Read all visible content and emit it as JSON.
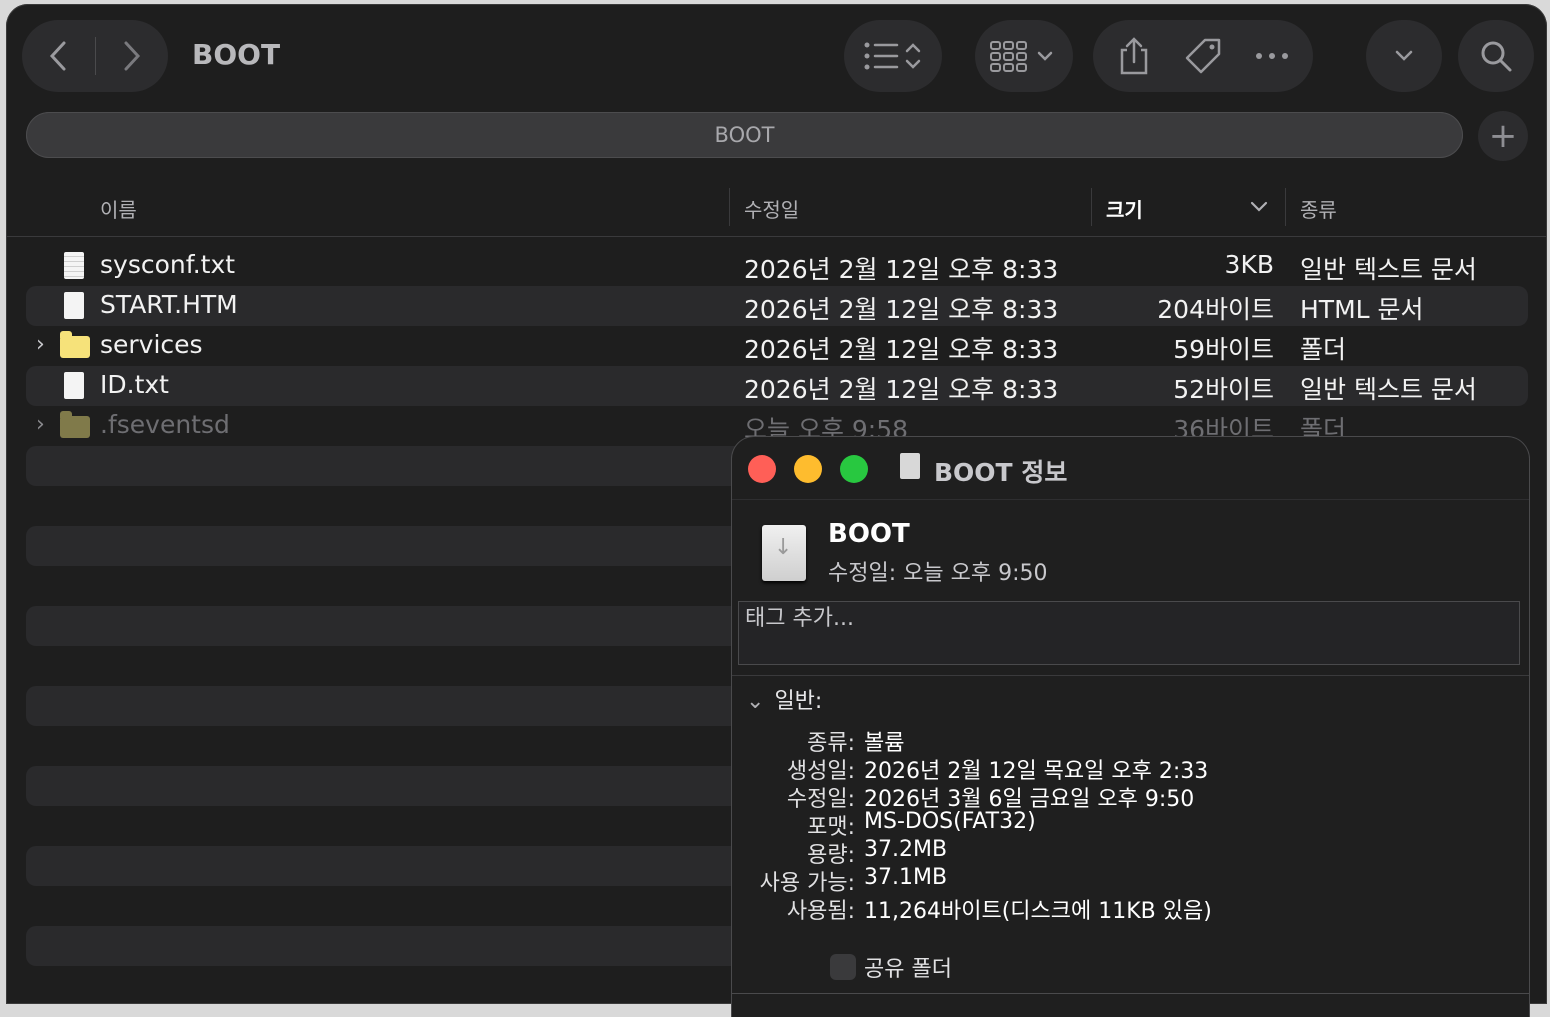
{
  "window": {
    "title": "BOOT"
  },
  "pathbar": {
    "label": "BOOT"
  },
  "columns": {
    "name": "이름",
    "modified": "수정일",
    "size": "크기",
    "kind": "종류"
  },
  "files": [
    {
      "name": "sysconf.txt",
      "modified": "2026년 2월 12일 오후 8:33",
      "size": "3KB",
      "kind": "일반 텍스트 문서",
      "icon": "text-file-icon"
    },
    {
      "name": "START.HTM",
      "modified": "2026년 2월 12일 오후 8:33",
      "size": "204바이트",
      "kind": "HTML 문서",
      "icon": "document-icon"
    },
    {
      "name": "services",
      "modified": "2026년 2월 12일 오후 8:33",
      "size": "59바이트",
      "kind": "폴더",
      "icon": "folder-icon"
    },
    {
      "name": "ID.txt",
      "modified": "2026년 2월 12일 오후 8:33",
      "size": "52바이트",
      "kind": "일반 텍스트 문서",
      "icon": "document-icon"
    },
    {
      "name": ".fseventsd",
      "modified": "오늘 오후 9:58",
      "size": "36바이트",
      "kind": "폴더",
      "icon": "folder-icon"
    }
  ],
  "info": {
    "title": "BOOT 정보",
    "name": "BOOT",
    "modified_line": "수정일: 오늘 오후 9:50",
    "tags_placeholder": "태그 추가...",
    "general_label": "일반:",
    "general": [
      {
        "key": "종류:",
        "value": "볼륨"
      },
      {
        "key": "생성일:",
        "value": "2026년 2월 12일 목요일 오후 2:33"
      },
      {
        "key": "수정일:",
        "value": "2026년 3월 6일 금요일 오후 9:50"
      },
      {
        "key": "포맷:",
        "value": "MS-DOS(FAT32)"
      },
      {
        "key": "용량:",
        "value": "37.2MB"
      },
      {
        "key": "사용 가능:",
        "value": "37.1MB"
      },
      {
        "key": "사용됨:",
        "value": "11,264바이트(디스크에 11KB 있음)"
      }
    ],
    "shared_folder": "공유 폴더"
  },
  "colors": {
    "folder": "#f6e27a",
    "close": "#ff5f57",
    "minimize": "#febc2e",
    "zoom": "#28c840"
  }
}
